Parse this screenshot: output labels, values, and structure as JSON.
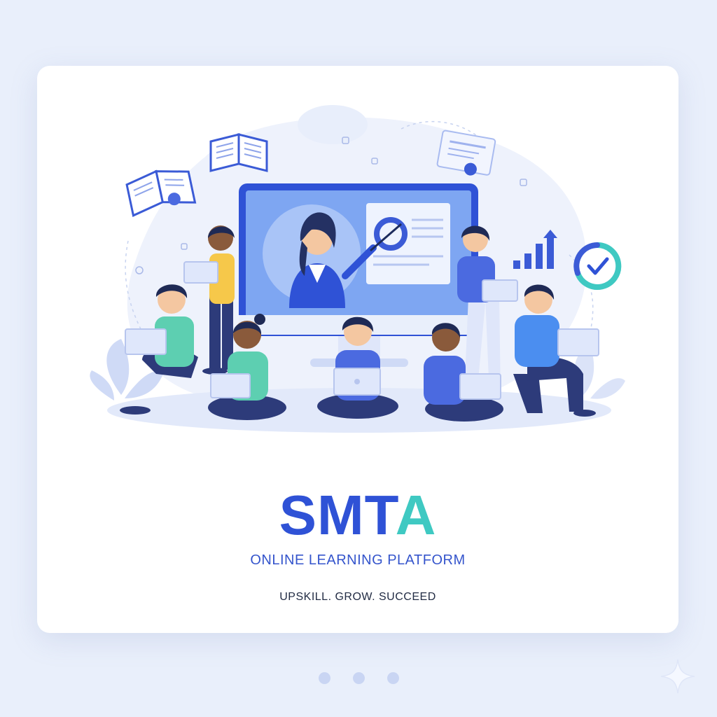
{
  "hero": {
    "brand_prefix": "SMT",
    "brand_accent": "A",
    "tagline": "ONLINE LEARNING PLATFORM",
    "slogan": "UPSKILL. GROW. SUCCEED"
  },
  "carousel": {
    "dots": [
      {
        "label": "slide-1"
      },
      {
        "label": "slide-2"
      },
      {
        "label": "slide-3"
      }
    ]
  },
  "colors": {
    "background": "#e9effb",
    "brand_blue": "#2f52d6",
    "brand_teal": "#3fc9c2",
    "ink": "#222c44"
  },
  "illustration": {
    "icons": [
      "open-book-icon",
      "certificate-icon",
      "bar-chart-icon",
      "checkmark-circle-icon",
      "monitor-icon"
    ]
  }
}
